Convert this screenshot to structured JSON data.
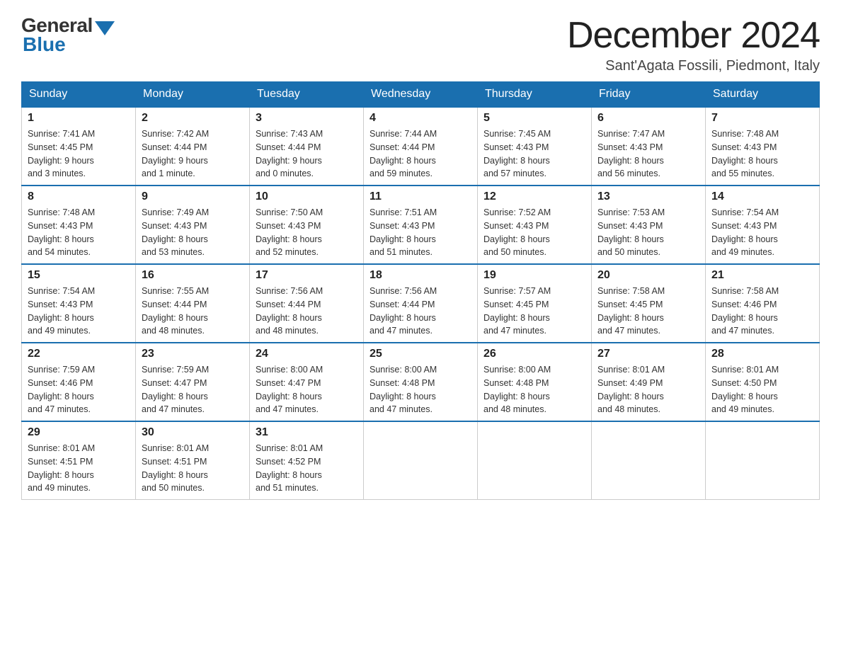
{
  "logo": {
    "general": "General",
    "blue": "Blue"
  },
  "title": "December 2024",
  "subtitle": "Sant'Agata Fossili, Piedmont, Italy",
  "days_of_week": [
    "Sunday",
    "Monday",
    "Tuesday",
    "Wednesday",
    "Thursday",
    "Friday",
    "Saturday"
  ],
  "weeks": [
    [
      {
        "day": "1",
        "sunrise": "7:41 AM",
        "sunset": "4:45 PM",
        "daylight": "9 hours and 3 minutes."
      },
      {
        "day": "2",
        "sunrise": "7:42 AM",
        "sunset": "4:44 PM",
        "daylight": "9 hours and 1 minute."
      },
      {
        "day": "3",
        "sunrise": "7:43 AM",
        "sunset": "4:44 PM",
        "daylight": "9 hours and 0 minutes."
      },
      {
        "day": "4",
        "sunrise": "7:44 AM",
        "sunset": "4:44 PM",
        "daylight": "8 hours and 59 minutes."
      },
      {
        "day": "5",
        "sunrise": "7:45 AM",
        "sunset": "4:43 PM",
        "daylight": "8 hours and 57 minutes."
      },
      {
        "day": "6",
        "sunrise": "7:47 AM",
        "sunset": "4:43 PM",
        "daylight": "8 hours and 56 minutes."
      },
      {
        "day": "7",
        "sunrise": "7:48 AM",
        "sunset": "4:43 PM",
        "daylight": "8 hours and 55 minutes."
      }
    ],
    [
      {
        "day": "8",
        "sunrise": "7:48 AM",
        "sunset": "4:43 PM",
        "daylight": "8 hours and 54 minutes."
      },
      {
        "day": "9",
        "sunrise": "7:49 AM",
        "sunset": "4:43 PM",
        "daylight": "8 hours and 53 minutes."
      },
      {
        "day": "10",
        "sunrise": "7:50 AM",
        "sunset": "4:43 PM",
        "daylight": "8 hours and 52 minutes."
      },
      {
        "day": "11",
        "sunrise": "7:51 AM",
        "sunset": "4:43 PM",
        "daylight": "8 hours and 51 minutes."
      },
      {
        "day": "12",
        "sunrise": "7:52 AM",
        "sunset": "4:43 PM",
        "daylight": "8 hours and 50 minutes."
      },
      {
        "day": "13",
        "sunrise": "7:53 AM",
        "sunset": "4:43 PM",
        "daylight": "8 hours and 50 minutes."
      },
      {
        "day": "14",
        "sunrise": "7:54 AM",
        "sunset": "4:43 PM",
        "daylight": "8 hours and 49 minutes."
      }
    ],
    [
      {
        "day": "15",
        "sunrise": "7:54 AM",
        "sunset": "4:43 PM",
        "daylight": "8 hours and 49 minutes."
      },
      {
        "day": "16",
        "sunrise": "7:55 AM",
        "sunset": "4:44 PM",
        "daylight": "8 hours and 48 minutes."
      },
      {
        "day": "17",
        "sunrise": "7:56 AM",
        "sunset": "4:44 PM",
        "daylight": "8 hours and 48 minutes."
      },
      {
        "day": "18",
        "sunrise": "7:56 AM",
        "sunset": "4:44 PM",
        "daylight": "8 hours and 47 minutes."
      },
      {
        "day": "19",
        "sunrise": "7:57 AM",
        "sunset": "4:45 PM",
        "daylight": "8 hours and 47 minutes."
      },
      {
        "day": "20",
        "sunrise": "7:58 AM",
        "sunset": "4:45 PM",
        "daylight": "8 hours and 47 minutes."
      },
      {
        "day": "21",
        "sunrise": "7:58 AM",
        "sunset": "4:46 PM",
        "daylight": "8 hours and 47 minutes."
      }
    ],
    [
      {
        "day": "22",
        "sunrise": "7:59 AM",
        "sunset": "4:46 PM",
        "daylight": "8 hours and 47 minutes."
      },
      {
        "day": "23",
        "sunrise": "7:59 AM",
        "sunset": "4:47 PM",
        "daylight": "8 hours and 47 minutes."
      },
      {
        "day": "24",
        "sunrise": "8:00 AM",
        "sunset": "4:47 PM",
        "daylight": "8 hours and 47 minutes."
      },
      {
        "day": "25",
        "sunrise": "8:00 AM",
        "sunset": "4:48 PM",
        "daylight": "8 hours and 47 minutes."
      },
      {
        "day": "26",
        "sunrise": "8:00 AM",
        "sunset": "4:48 PM",
        "daylight": "8 hours and 48 minutes."
      },
      {
        "day": "27",
        "sunrise": "8:01 AM",
        "sunset": "4:49 PM",
        "daylight": "8 hours and 48 minutes."
      },
      {
        "day": "28",
        "sunrise": "8:01 AM",
        "sunset": "4:50 PM",
        "daylight": "8 hours and 49 minutes."
      }
    ],
    [
      {
        "day": "29",
        "sunrise": "8:01 AM",
        "sunset": "4:51 PM",
        "daylight": "8 hours and 49 minutes."
      },
      {
        "day": "30",
        "sunrise": "8:01 AM",
        "sunset": "4:51 PM",
        "daylight": "8 hours and 50 minutes."
      },
      {
        "day": "31",
        "sunrise": "8:01 AM",
        "sunset": "4:52 PM",
        "daylight": "8 hours and 51 minutes."
      },
      null,
      null,
      null,
      null
    ]
  ],
  "labels": {
    "sunrise": "Sunrise:",
    "sunset": "Sunset:",
    "daylight": "Daylight:"
  },
  "colors": {
    "header_bg": "#1a6faf",
    "header_text": "#ffffff",
    "border": "#cccccc",
    "title": "#222222"
  }
}
